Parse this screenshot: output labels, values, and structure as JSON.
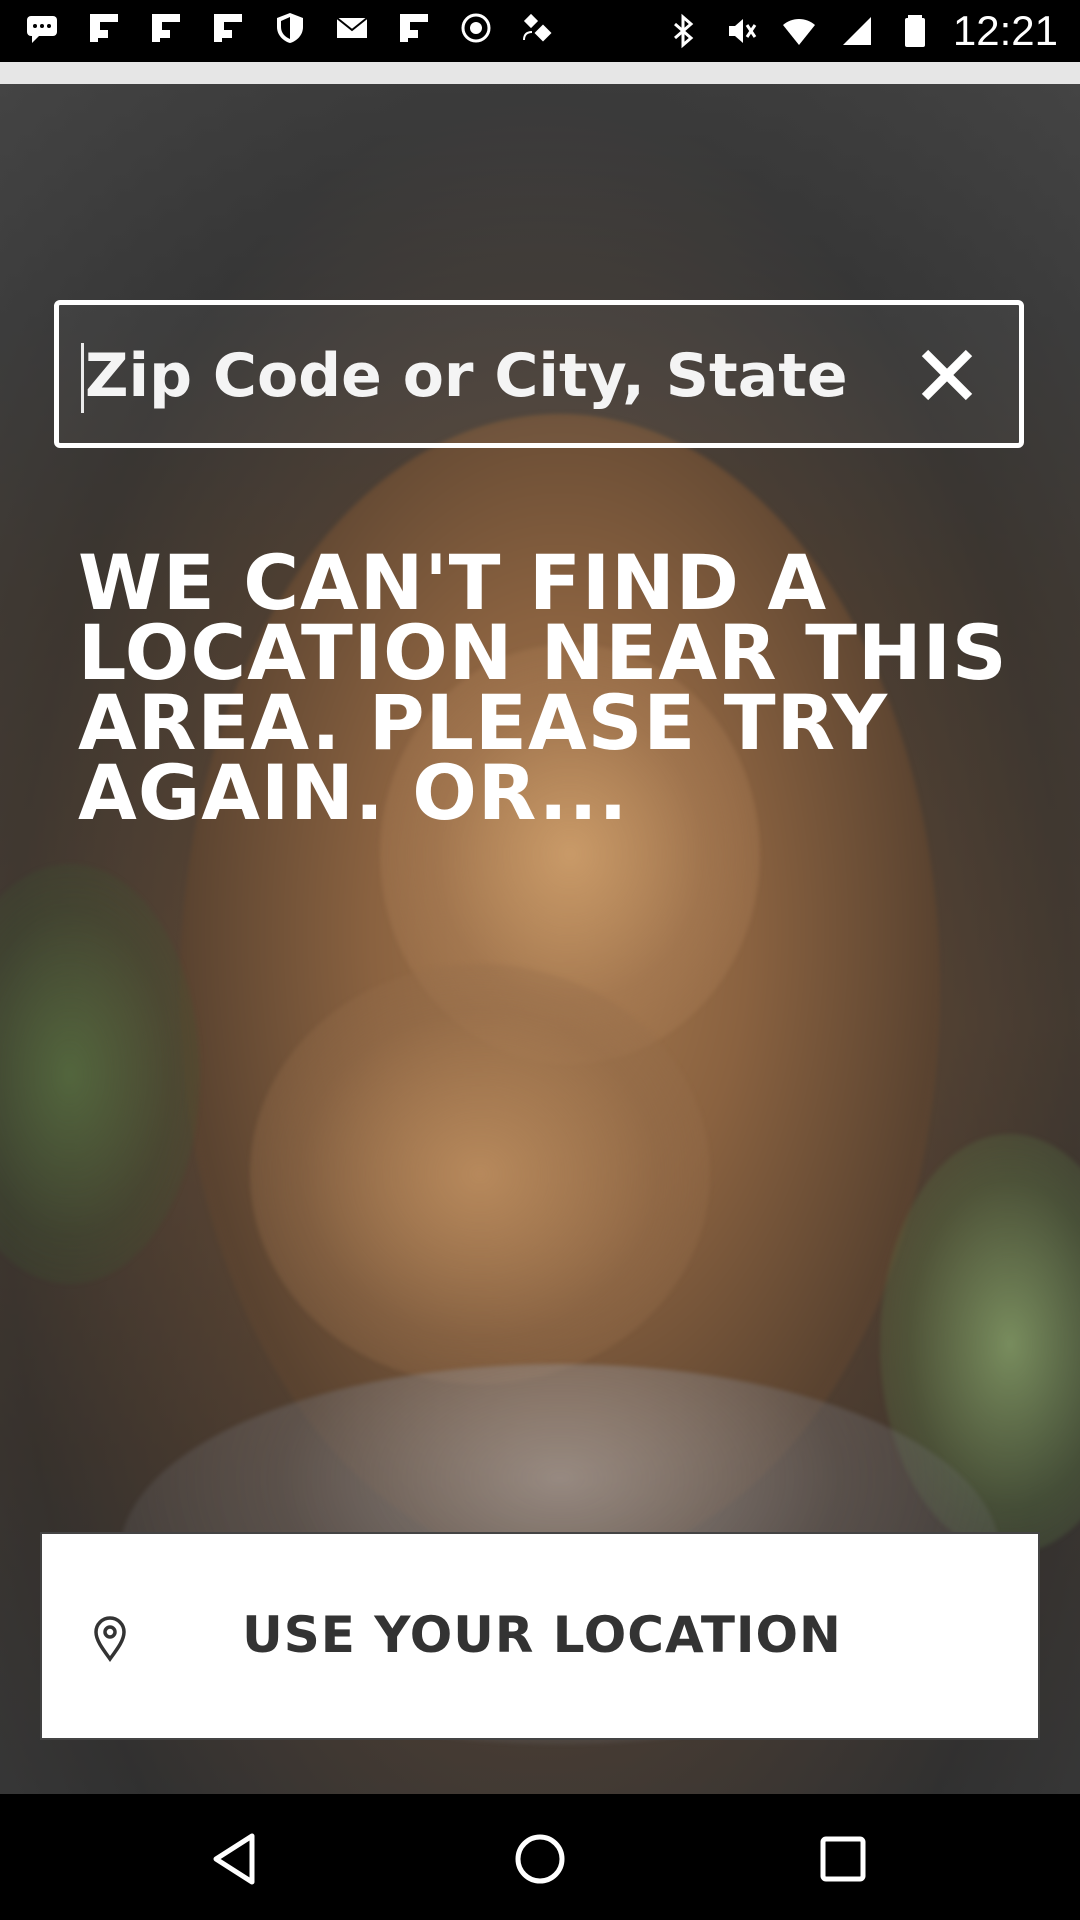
{
  "status_bar": {
    "time": "12:21",
    "left_icons": [
      "chat-bubble-icon",
      "flipboard-icon",
      "flipboard-icon",
      "flipboard-icon",
      "shield-icon",
      "mail-icon",
      "flipboard-icon",
      "circle-icon",
      "fake-gps-icon"
    ],
    "right_icons": [
      "bluetooth-icon",
      "mute-icon",
      "wifi-icon",
      "signal-icon",
      "battery-icon"
    ]
  },
  "search": {
    "placeholder": "Zip Code or City, State",
    "value": ""
  },
  "message": {
    "text": "WE CAN'T FIND A LOCATION NEAR THIS AREA. PLEASE TRY AGAIN. OR..."
  },
  "location_button": {
    "label": "USE YOUR LOCATION",
    "icon": "map-pin-icon"
  },
  "nav_bar": {
    "buttons": [
      "back-icon",
      "home-icon",
      "recents-icon"
    ]
  },
  "colors": {
    "overlay": "#4a4a4a",
    "text": "#ffffff",
    "button_bg": "#ffffff",
    "button_text": "#333333"
  }
}
